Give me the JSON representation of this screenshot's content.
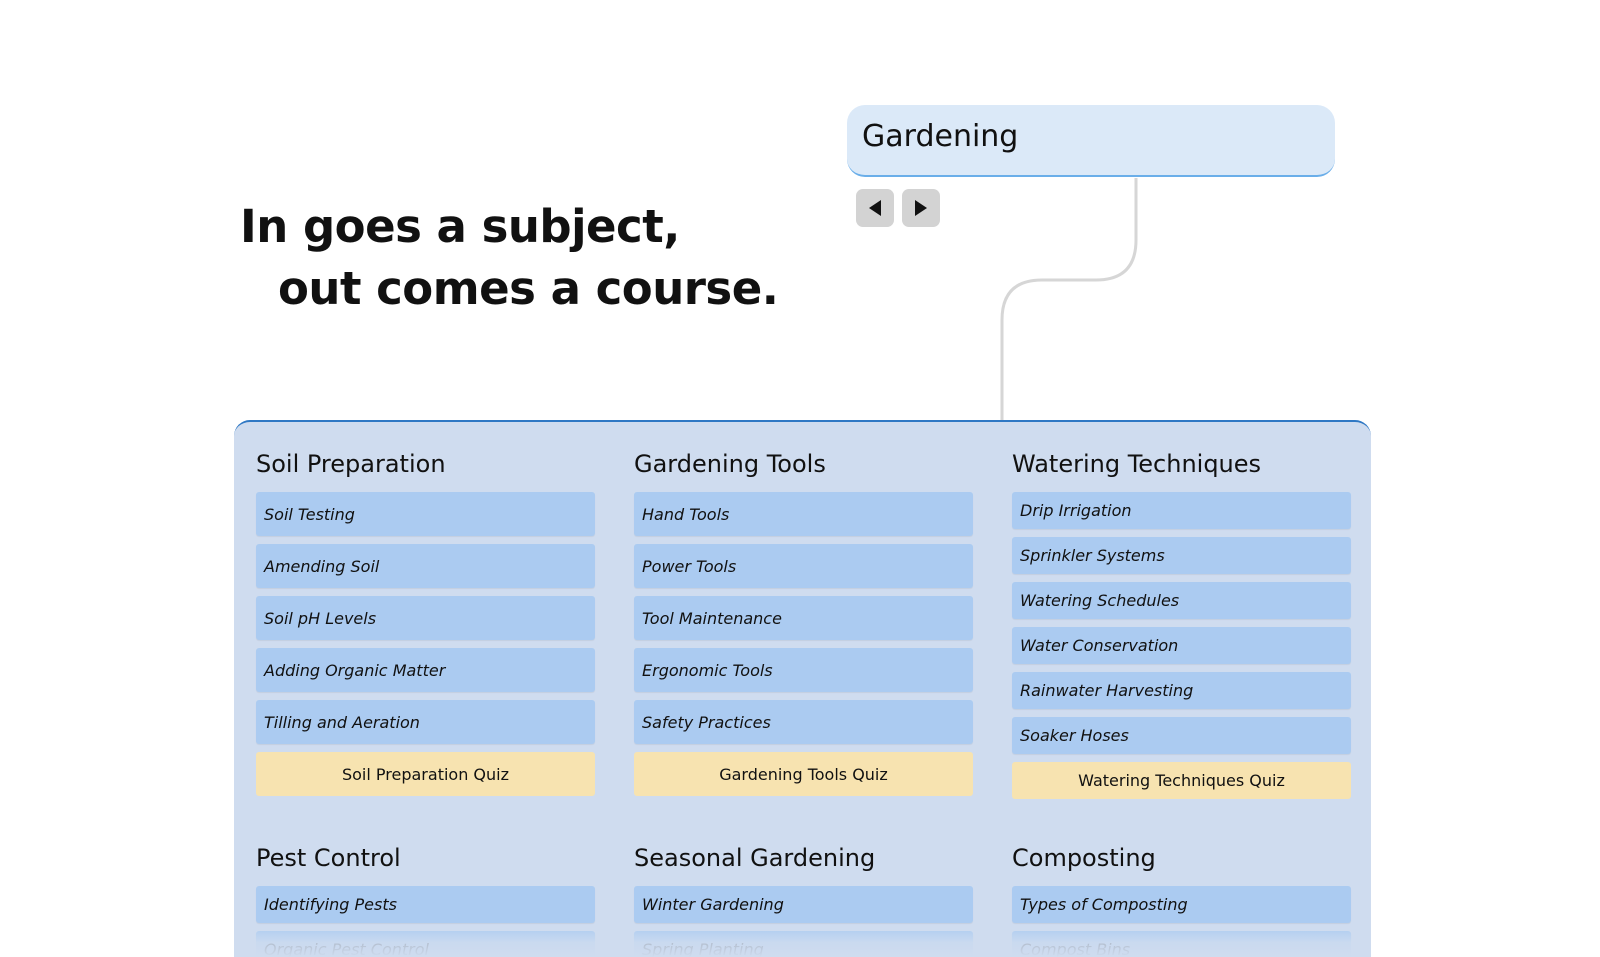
{
  "tagline": {
    "line1": "In goes a subject,",
    "line2": "out comes a course."
  },
  "subject_input": {
    "value": "Gardening"
  },
  "nav": {
    "prev_icon": "triangle-left-icon",
    "next_icon": "triangle-right-icon"
  },
  "colors": {
    "panel": "#cfdcef",
    "lesson": "#abcbf1",
    "quiz": "#f7e3b0",
    "subject_box": "#dbe9f8",
    "accent": "#2f78c4"
  },
  "modules": [
    {
      "title": "Soil Preparation",
      "lessons": [
        "Soil Testing",
        "Amending Soil",
        "Soil pH Levels",
        "Adding Organic Matter",
        "Tilling and Aeration"
      ],
      "quiz": "Soil Preparation Quiz"
    },
    {
      "title": "Gardening Tools",
      "lessons": [
        "Hand Tools",
        "Power Tools",
        "Tool Maintenance",
        "Ergonomic Tools",
        "Safety Practices"
      ],
      "quiz": "Gardening Tools Quiz"
    },
    {
      "title": "Watering Techniques",
      "lessons": [
        "Drip Irrigation",
        "Sprinkler Systems",
        "Watering Schedules",
        "Water Conservation",
        "Rainwater Harvesting",
        "Soaker Hoses"
      ],
      "quiz": "Watering Techniques Quiz"
    },
    {
      "title": "Pest Control",
      "lessons": [
        "Identifying Pests",
        "Organic Pest Control"
      ]
    },
    {
      "title": "Seasonal Gardening",
      "lessons": [
        "Winter Gardening",
        "Spring Planting"
      ]
    },
    {
      "title": "Composting",
      "lessons": [
        "Types of Composting",
        "Compost Bins"
      ]
    }
  ]
}
